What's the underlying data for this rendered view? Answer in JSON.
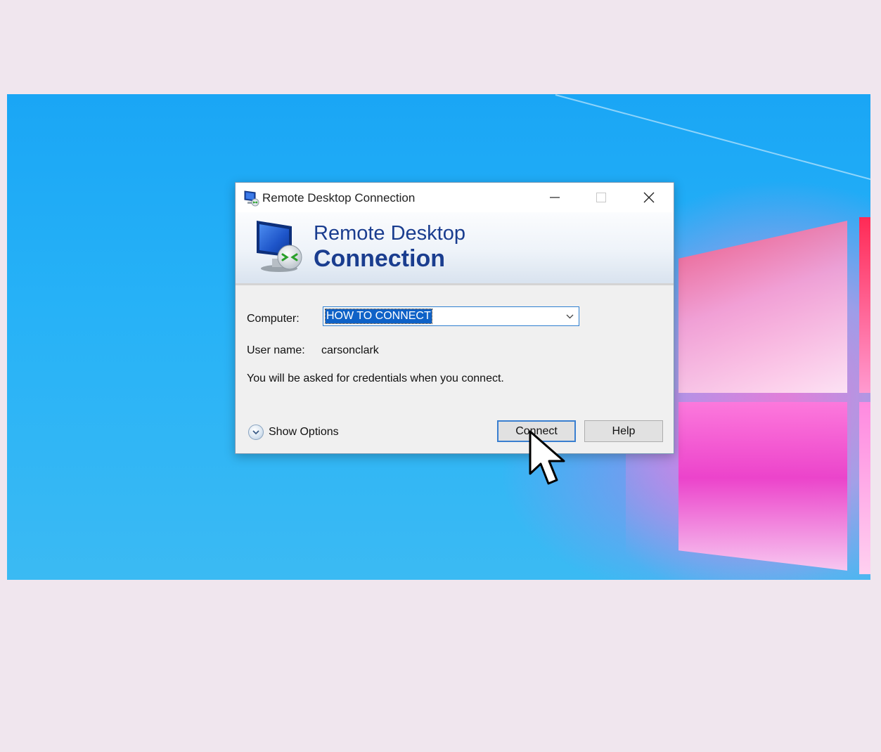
{
  "window": {
    "title": "Remote Desktop Connection",
    "controls": {
      "minimize": "minimize",
      "maximize": "maximize",
      "close": "close"
    }
  },
  "banner": {
    "line1": "Remote Desktop",
    "line2": "Connection"
  },
  "form": {
    "computer_label": "Computer:",
    "computer_value": "HOW TO CONNECT",
    "username_label": "User name:",
    "username_value": "carsonclark",
    "info_text": "You will be asked for credentials when you connect."
  },
  "footer": {
    "show_options_label": "Show Options",
    "connect_label": "Connect",
    "help_label": "Help"
  },
  "colors": {
    "accent": "#1a3d8f",
    "selection": "#0f62c7",
    "desktop": "#1aa6f5"
  },
  "icons": [
    "rdp-monitor-icon",
    "chevron-down-icon",
    "expand-circle-icon",
    "mouse-pointer-icon"
  ]
}
